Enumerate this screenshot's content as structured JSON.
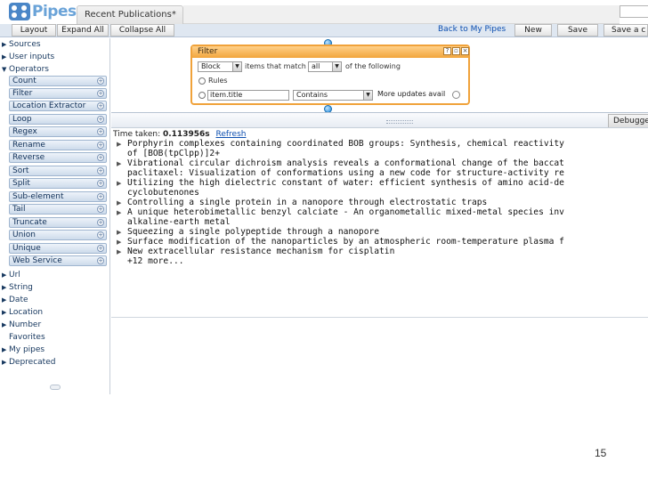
{
  "app": {
    "logo_text": "Pipes",
    "tab_title": "Recent Publications*"
  },
  "toolbar": {
    "layout": "Layout",
    "expand_all": "Expand All",
    "collapse_all": "Collapse All",
    "back_link": "Back to My Pipes",
    "new": "New",
    "save": "Save",
    "save_as": "Save a c"
  },
  "sidebar": {
    "sources": "Sources",
    "user_inputs": "User inputs",
    "operators": "Operators",
    "operator_items": [
      "Count",
      "Filter",
      "Location Extractor",
      "Loop",
      "Regex",
      "Rename",
      "Reverse",
      "Sort",
      "Split",
      "Sub-element",
      "Tail",
      "Truncate",
      "Union",
      "Unique",
      "Web Service"
    ],
    "url": "Url",
    "string": "String",
    "date": "Date",
    "location": "Location",
    "number": "Number",
    "favorites": "Favorites",
    "my_pipes": "My pipes",
    "deprecated": "Deprecated"
  },
  "filter": {
    "title": "Filter",
    "mode": "Block",
    "items_that_match": "items that match",
    "match": "all",
    "of_following": "of the following",
    "rules": "Rules",
    "field": "item.title",
    "operator": "Contains",
    "value": "More updates avail"
  },
  "debugger": {
    "tab": "Debugger",
    "time_label": "Time taken:",
    "time_value": "0.113956s",
    "refresh": "Refresh",
    "results": [
      "Porphyrin complexes containing coordinated BOB groups: Synthesis, chemical reactivity",
      "of [BOB(tpClpp)]2+",
      "Vibrational circular dichroism analysis reveals a conformational change of the baccat",
      "paclitaxel: Visualization of conformations using a new code for structure-activity re",
      "Utilizing the high dielectric constant of water: efficient synthesis of amino acid-de",
      "cyclobutenones",
      "Controlling a single protein in a nanopore through electrostatic traps",
      "A unique heterobimetallic benzyl calciate - An organometallic mixed-metal species inv",
      "alkaline-earth metal",
      "Squeezing a single polypeptide through a nanopore",
      "Surface modification of the nanoparticles by an atmospheric room-temperature plasma f",
      "New extracellular resistance mechanism for cisplatin",
      "+12 more..."
    ]
  },
  "page_number": "15"
}
